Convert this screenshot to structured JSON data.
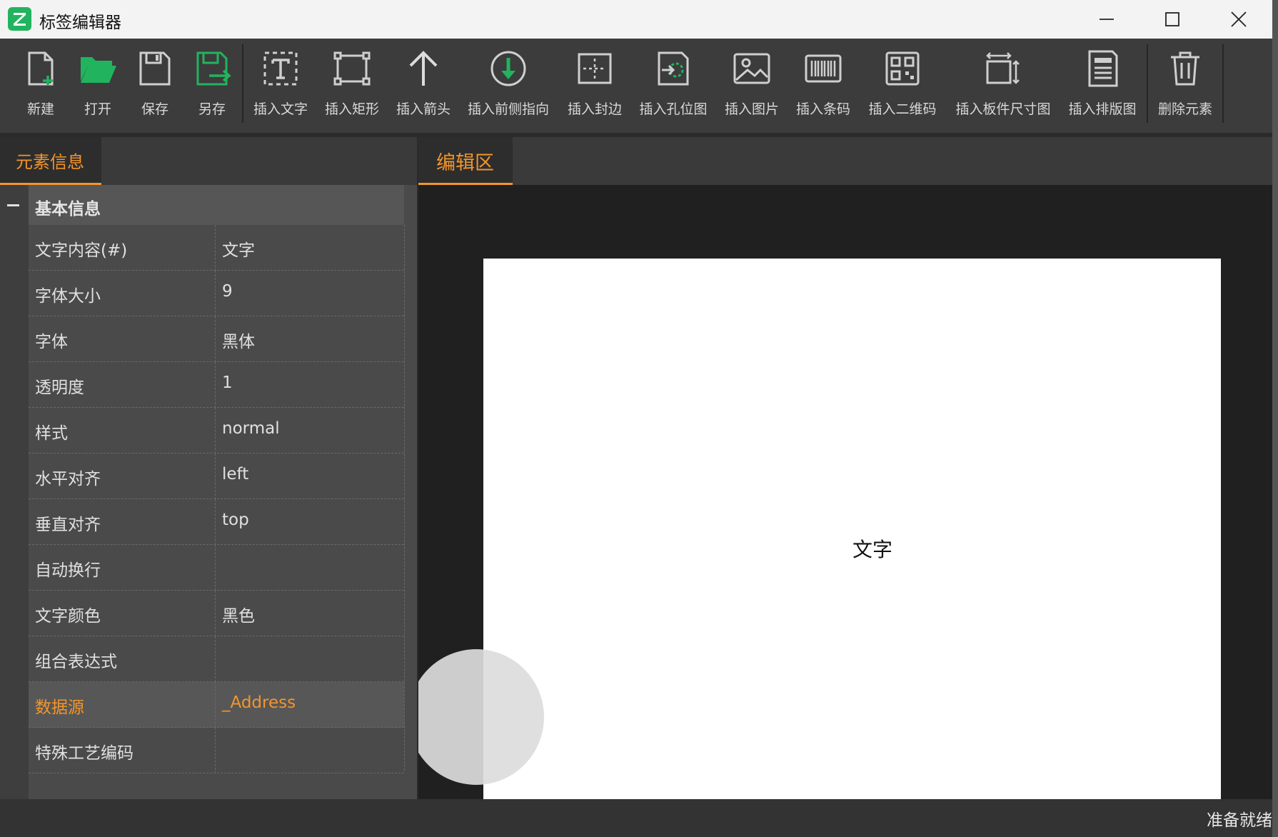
{
  "window": {
    "title": "标签编辑器",
    "logo_letter": "Z",
    "accent_color": "#f3952b",
    "logo_color": "#22b35e"
  },
  "toolbar": {
    "items": [
      {
        "label": "新建",
        "icon": "new-file-icon"
      },
      {
        "label": "打开",
        "icon": "folder-open-icon"
      },
      {
        "label": "保存",
        "icon": "save-icon"
      },
      {
        "label": "另存",
        "icon": "save-as-icon"
      },
      {
        "label": "插入文字",
        "icon": "insert-text-icon"
      },
      {
        "label": "插入矩形",
        "icon": "insert-rect-icon"
      },
      {
        "label": "插入箭头",
        "icon": "arrow-up-icon"
      },
      {
        "label": "插入前侧指向",
        "icon": "front-pointer-icon"
      },
      {
        "label": "插入封边",
        "icon": "edge-banding-icon"
      },
      {
        "label": "插入孔位图",
        "icon": "hole-map-icon"
      },
      {
        "label": "插入图片",
        "icon": "image-icon"
      },
      {
        "label": "插入条码",
        "icon": "barcode-icon"
      },
      {
        "label": "插入二维码",
        "icon": "qrcode-icon"
      },
      {
        "label": "插入板件尺寸图",
        "icon": "board-size-icon"
      },
      {
        "label": "插入排版图",
        "icon": "layout-icon"
      },
      {
        "label": "删除元素",
        "icon": "trash-icon"
      }
    ]
  },
  "left_panel": {
    "tab_label": "元素信息",
    "category": "基本信息",
    "properties": [
      {
        "name": "文字内容(#)",
        "value": "文字"
      },
      {
        "name": "字体大小",
        "value": "9"
      },
      {
        "name": "字体",
        "value": "黑体"
      },
      {
        "name": "透明度",
        "value": "1"
      },
      {
        "name": "样式",
        "value": "normal"
      },
      {
        "name": "水平对齐",
        "value": "left"
      },
      {
        "name": "垂直对齐",
        "value": "top"
      },
      {
        "name": "自动换行",
        "value": ""
      },
      {
        "name": "文字颜色",
        "value": "黑色"
      },
      {
        "name": "组合表达式",
        "value": ""
      },
      {
        "name": "数据源",
        "value": "_Address",
        "selected": true
      },
      {
        "name": "特殊工艺编码",
        "value": ""
      }
    ]
  },
  "right_panel": {
    "tab_label": "编辑区",
    "canvas_text": "文字"
  },
  "status": {
    "text": "准备就绪"
  }
}
